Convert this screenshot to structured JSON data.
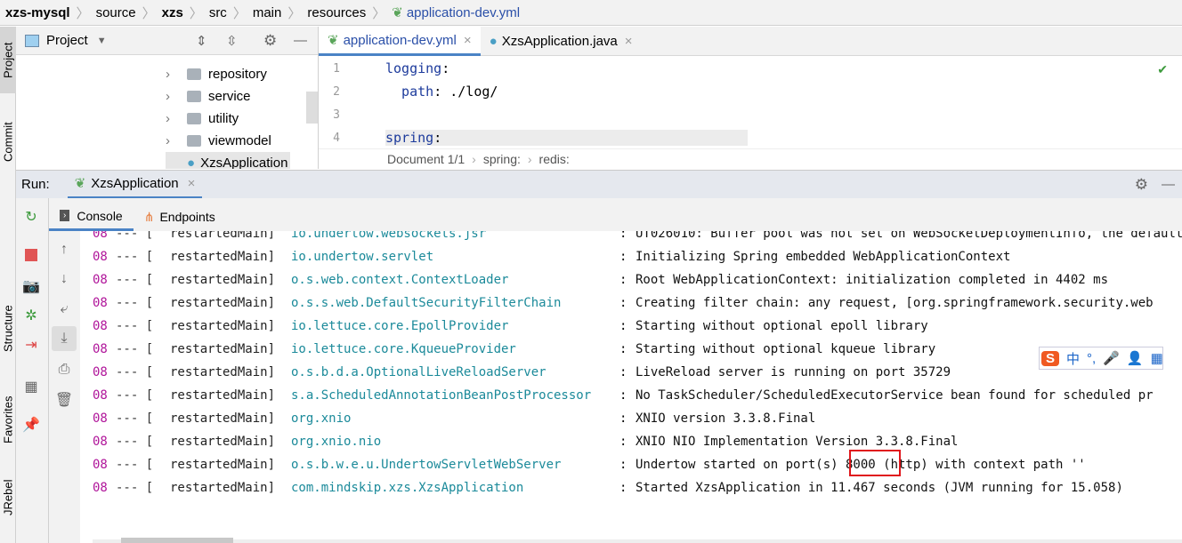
{
  "breadcrumb": [
    "xzs-mysql",
    "source",
    "xzs",
    "src",
    "main",
    "resources",
    "application-dev.yml"
  ],
  "side_tools": [
    "Project",
    "Commit",
    "Structure",
    "Favorites",
    "JRebel"
  ],
  "project_panel": {
    "title": "Project",
    "items": [
      "repository",
      "service",
      "utility",
      "viewmodel",
      "XzsApplication"
    ]
  },
  "editor": {
    "tabs": [
      {
        "label": "application-dev.yml",
        "active": true
      },
      {
        "label": "XzsApplication.java",
        "active": false
      }
    ],
    "lines": [
      {
        "n": "1",
        "key": "logging",
        "rest": ":"
      },
      {
        "n": "2",
        "key": "  path",
        "rest": ": ./log/"
      },
      {
        "n": "3",
        "key": "",
        "rest": ""
      },
      {
        "n": "4",
        "key": "spring",
        "rest": ":"
      }
    ],
    "status": [
      "Document 1/1",
      "spring:",
      "redis:"
    ]
  },
  "run": {
    "label": "Run:",
    "config": "XzsApplication",
    "tabs": [
      "Console",
      "Endpoints"
    ]
  },
  "console": {
    "prefix": "08",
    "dash": "--- [",
    "thread": "restartedMain]",
    "lines": [
      {
        "logger": "io.undertow.websockets.jsr",
        "msg": "UT026010: Buffer pool was not set on WebSocketDeploymentInfo, the default"
      },
      {
        "logger": "io.undertow.servlet",
        "msg": "Initializing Spring embedded WebApplicationContext"
      },
      {
        "logger": "o.s.web.context.ContextLoader",
        "msg": "Root WebApplicationContext: initialization completed in 4402 ms"
      },
      {
        "logger": "o.s.s.web.DefaultSecurityFilterChain",
        "msg": "Creating filter chain: any request, [org.springframework.security.web"
      },
      {
        "logger": "io.lettuce.core.EpollProvider",
        "msg": "Starting without optional epoll library"
      },
      {
        "logger": "io.lettuce.core.KqueueProvider",
        "msg": "Starting without optional kqueue library"
      },
      {
        "logger": "o.s.b.d.a.OptionalLiveReloadServer",
        "msg": "LiveReload server is running on port 35729"
      },
      {
        "logger": "s.a.ScheduledAnnotationBeanPostProcessor",
        "msg": "No TaskScheduler/ScheduledExecutorService bean found for scheduled pr"
      },
      {
        "logger": "org.xnio",
        "msg": "XNIO version 3.3.8.Final"
      },
      {
        "logger": "org.xnio.nio",
        "msg": "XNIO NIO Implementation Version 3.3.8.Final"
      },
      {
        "logger": "o.s.b.w.e.u.UndertowServletWebServer",
        "msg": "Undertow started on port(s) 8000 (http) with context path ''"
      },
      {
        "logger": "com.mindskip.xzs.XzsApplication",
        "msg": "Started XzsApplication in 11.467 seconds (JVM running for 15.058)"
      }
    ]
  },
  "ime": {
    "lang": "中",
    "punct": "°,"
  },
  "colors": {
    "highlight": "#e0161b",
    "logger": "#1b8a9a",
    "pid": "#b0159a",
    "accent": "#4a83c5"
  }
}
